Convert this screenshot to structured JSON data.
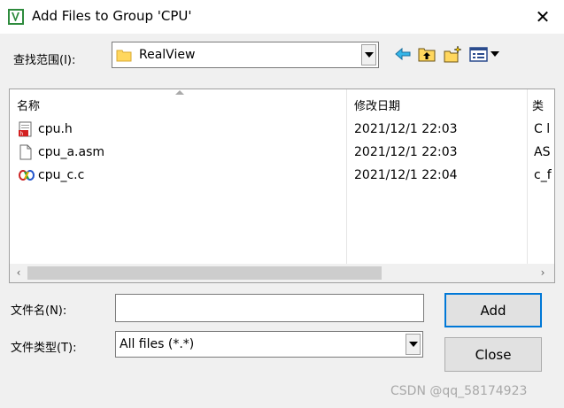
{
  "window": {
    "title": "Add Files to Group 'CPU'",
    "close_glyph": "✕"
  },
  "look_in": {
    "label": "查找范围(I):",
    "value": "RealView"
  },
  "toolbar": {
    "icons": [
      "back-icon",
      "up-folder-icon",
      "new-folder-icon",
      "view-menu-icon"
    ]
  },
  "file_list": {
    "columns": [
      "名称",
      "修改日期",
      "类"
    ],
    "rows": [
      {
        "name": "cpu.h",
        "date": "2021/12/1 22:03",
        "type": "C l",
        "icon": "c-header-file-icon"
      },
      {
        "name": "cpu_a.asm",
        "date": "2021/12/1 22:03",
        "type": "AS",
        "icon": "blank-file-icon"
      },
      {
        "name": "cpu_c.c",
        "date": "2021/12/1 22:04",
        "type": "c_f",
        "icon": "c-source-file-icon"
      }
    ]
  },
  "file_name": {
    "label": "文件名(N):",
    "value": ""
  },
  "file_type": {
    "label": "文件类型(T):",
    "value": "All files (*.*)"
  },
  "buttons": {
    "add": "Add",
    "close": "Close"
  },
  "watermark": "CSDN @qq_58174923",
  "colors": {
    "accent": "#0078d7",
    "dialog_bg": "#f0f0f0",
    "folder": "#ffd75e"
  }
}
